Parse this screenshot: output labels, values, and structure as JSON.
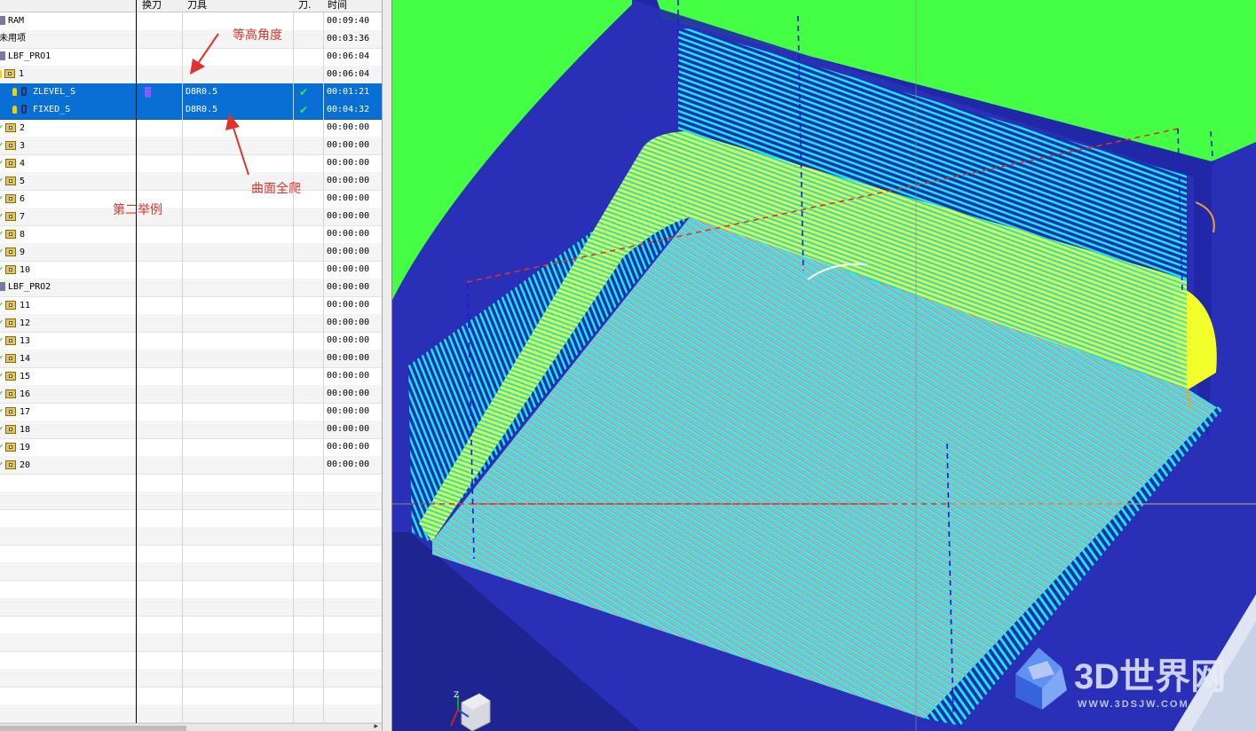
{
  "nav": {
    "columns": {
      "exchange": "换刀",
      "tool": "刀具",
      "tool_short": "刀.",
      "time": "时间"
    },
    "rows": [
      {
        "name": "RAM",
        "time": "00:09:40",
        "icon": "program-icon",
        "indent": 0
      },
      {
        "name": "未用项",
        "time": "00:03:36",
        "icon": "none",
        "indent": 0
      },
      {
        "name": "LBF_PRO1",
        "time": "00:06:04",
        "icon": "program-icon",
        "indent": 0
      },
      {
        "name": "1",
        "time": "00:06:04",
        "icon": "bulb-folder-icon",
        "indent": 1
      },
      {
        "name": "ZLEVEL_S",
        "tool": "D8R0.5",
        "time": "00:01:21",
        "selected": true,
        "exchange": true,
        "checked": true,
        "icon": "operation-icon",
        "indent": 2
      },
      {
        "name": "FIXED_S",
        "tool": "D8R0.5",
        "time": "00:04:32",
        "selected": true,
        "exchange": false,
        "checked": true,
        "icon": "operation-icon",
        "indent": 2
      },
      {
        "name": "2",
        "time": "00:00:00",
        "icon": "check-folder-icon",
        "indent": 1
      },
      {
        "name": "3",
        "time": "00:00:00",
        "icon": "check-folder-icon",
        "indent": 1
      },
      {
        "name": "4",
        "time": "00:00:00",
        "icon": "check-folder-icon",
        "indent": 1
      },
      {
        "name": "5",
        "time": "00:00:00",
        "icon": "check-folder-icon",
        "indent": 1
      },
      {
        "name": "6",
        "time": "00:00:00",
        "icon": "check-folder-icon",
        "indent": 1
      },
      {
        "name": "7",
        "time": "00:00:00",
        "icon": "check-folder-icon",
        "indent": 1
      },
      {
        "name": "8",
        "time": "00:00:00",
        "icon": "check-folder-icon",
        "indent": 1
      },
      {
        "name": "9",
        "time": "00:00:00",
        "icon": "check-folder-icon",
        "indent": 1
      },
      {
        "name": "10",
        "time": "00:00:00",
        "icon": "check-folder-icon",
        "indent": 1
      },
      {
        "name": "LBF_PRO2",
        "time": "00:00:00",
        "icon": "program-icon",
        "indent": 0
      },
      {
        "name": "11",
        "time": "00:00:00",
        "icon": "check-folder-icon",
        "indent": 1
      },
      {
        "name": "12",
        "time": "00:00:00",
        "icon": "check-folder-icon",
        "indent": 1
      },
      {
        "name": "13",
        "time": "00:00:00",
        "icon": "check-folder-icon",
        "indent": 1
      },
      {
        "name": "14",
        "time": "00:00:00",
        "icon": "check-folder-icon",
        "indent": 1
      },
      {
        "name": "15",
        "time": "00:00:00",
        "icon": "check-folder-icon",
        "indent": 1
      },
      {
        "name": "16",
        "time": "00:00:00",
        "icon": "check-folder-icon",
        "indent": 1
      },
      {
        "name": "17",
        "time": "00:00:00",
        "icon": "check-folder-icon",
        "indent": 1
      },
      {
        "name": "18",
        "time": "00:00:00",
        "icon": "check-folder-icon",
        "indent": 1
      },
      {
        "name": "19",
        "time": "00:00:00",
        "icon": "check-folder-icon",
        "indent": 1
      },
      {
        "name": "20",
        "time": "00:00:00",
        "icon": "check-folder-icon",
        "indent": 1
      }
    ],
    "empty_rows": 14
  },
  "annotations": {
    "zlevel_note": "等高角度",
    "fixed_note": "曲面全爬",
    "example_note": "第二举例"
  },
  "viewport": {
    "axis_label": "Z",
    "watermark_title": "3D世界网",
    "watermark_url": "WWW.3DSJW.COM",
    "colors": {
      "background": "#2a2fb8",
      "green_face": "#44ff44",
      "toolpath_cyan": "#19e6f0",
      "toolpath_yellow": "#f2ff2a",
      "selection_blue": "#0a6fd4"
    }
  }
}
